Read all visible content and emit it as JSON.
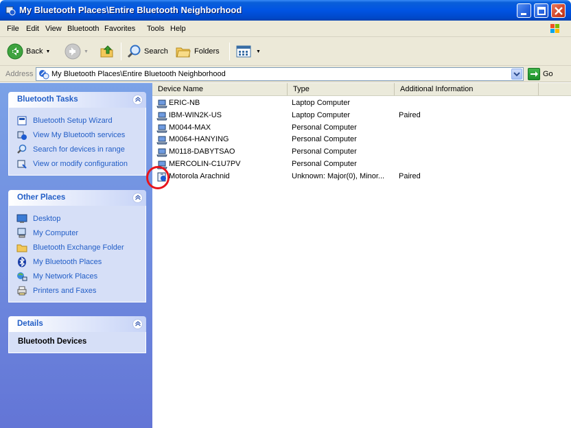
{
  "window": {
    "title": "My Bluetooth Places\\Entire Bluetooth Neighborhood"
  },
  "menu": [
    "File",
    "Edit",
    "View",
    "Bluetooth",
    "Favorites",
    "Tools",
    "Help"
  ],
  "toolbar": {
    "back_label": "Back",
    "search_label": "Search",
    "folders_label": "Folders"
  },
  "address": {
    "label": "Address",
    "value": "My Bluetooth Places\\Entire Bluetooth Neighborhood",
    "go_label": "Go"
  },
  "tasks": {
    "title": "Bluetooth Tasks",
    "items": [
      {
        "label": "Bluetooth Setup Wizard",
        "icon": "wizard-icon"
      },
      {
        "label": "View My Bluetooth services",
        "icon": "services-icon"
      },
      {
        "label": "Search for devices in range",
        "icon": "search-devices-icon"
      },
      {
        "label": "View or modify configuration",
        "icon": "configuration-icon"
      }
    ]
  },
  "other_places": {
    "title": "Other Places",
    "items": [
      {
        "label": "Desktop",
        "icon": "desktop-icon"
      },
      {
        "label": "My Computer",
        "icon": "my-computer-icon"
      },
      {
        "label": "Bluetooth Exchange Folder",
        "icon": "folder-icon"
      },
      {
        "label": "My Bluetooth Places",
        "icon": "bluetooth-icon"
      },
      {
        "label": "My Network Places",
        "icon": "network-places-icon"
      },
      {
        "label": "Printers and Faxes",
        "icon": "printer-icon"
      }
    ]
  },
  "details": {
    "title": "Details",
    "text": "Bluetooth Devices"
  },
  "columns": [
    "Device Name",
    "Type",
    "Additional Information"
  ],
  "devices": [
    {
      "name": "ERIC-NB",
      "type": "Laptop Computer",
      "info": ""
    },
    {
      "name": "IBM-WIN2K-US",
      "type": "Laptop Computer",
      "info": "Paired"
    },
    {
      "name": "M0044-MAX",
      "type": "Personal Computer",
      "info": ""
    },
    {
      "name": "M0064-HANYING",
      "type": "Personal Computer",
      "info": ""
    },
    {
      "name": "M0118-DABYTSAO",
      "type": "Personal Computer",
      "info": ""
    },
    {
      "name": "MERCOLIN-C1U7PV",
      "type": "Personal Computer",
      "info": ""
    },
    {
      "name": "Motorola Arachnid",
      "type": "Unknown: Major(0), Minor...",
      "info": "Paired"
    }
  ],
  "colors": {
    "title_blue": "#0054e3",
    "link_blue": "#215dc6",
    "pane_blue": "#6f8cde",
    "highlight_red": "#e8141b"
  }
}
